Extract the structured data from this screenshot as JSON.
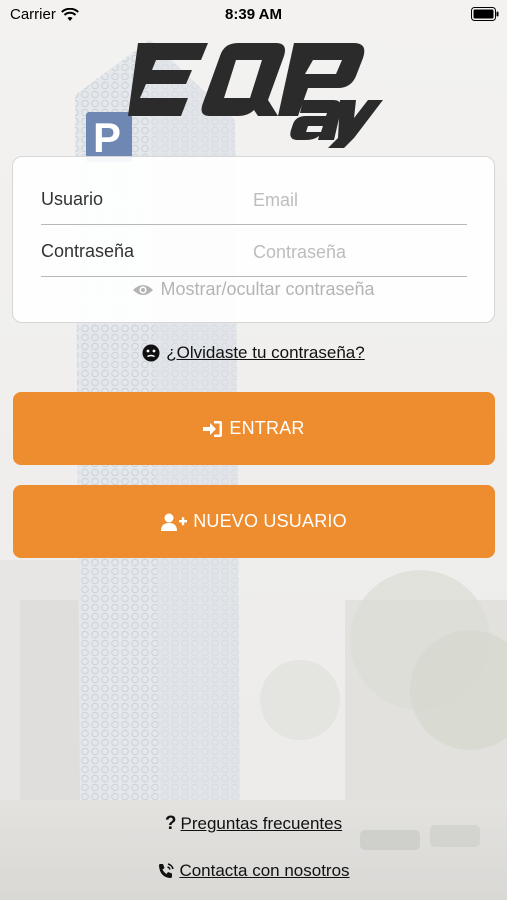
{
  "status_bar": {
    "carrier": "Carrier",
    "time": "8:39 AM"
  },
  "logo": {
    "alt_text": "EQPay"
  },
  "login": {
    "user_label": "Usuario",
    "user_placeholder": "Email",
    "user_value": "",
    "password_label": "Contraseña",
    "password_placeholder": "Contraseña",
    "password_value": "",
    "toggle_label": "Mostrar/ocultar contraseña"
  },
  "forgot_password": "¿Olvidaste tu contraseña?",
  "buttons": {
    "enter": "ENTRAR",
    "new_user": "NUEVO USUARIO"
  },
  "footer": {
    "faq": "Preguntas frecuentes",
    "contact": "Contacta con nosotros"
  },
  "colors": {
    "accent": "#ee8d2f",
    "logo": "#2b2b2b"
  }
}
